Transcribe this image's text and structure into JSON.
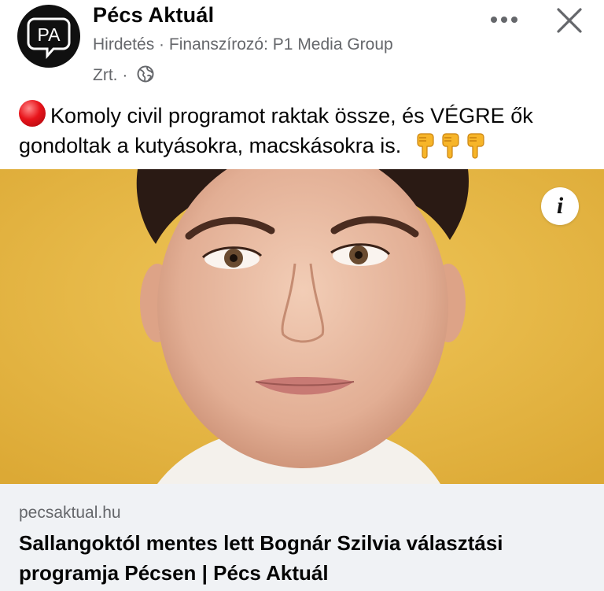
{
  "post": {
    "page_name": "Pécs Aktuál",
    "avatar_text": "PA",
    "sponsored_label": "Hirdetés",
    "separator": "·",
    "sponsor_prefix": "Finanszírozó:",
    "sponsor_name_part1": "P1 Media Group",
    "sponsor_name_part2": "Zrt.",
    "privacy_icon": "globe-icon",
    "more_label": "•••",
    "close_icon": "close-icon"
  },
  "caption": {
    "emoji_start": "red-circle",
    "line1": "Komoly civil programot raktak össze, és VÉGRE ők",
    "line2": "gondoltak a kutyásokra, macskásokra is.",
    "hand_emojis": [
      "pointing-down-hand",
      "pointing-down-hand",
      "pointing-down-hand"
    ]
  },
  "media": {
    "description_icon": "portrait-photo",
    "background_color": "#e4b441",
    "info_label": "i"
  },
  "link_preview": {
    "domain": "pecsaktual.hu",
    "title": "Sallangoktól mentes lett Bognár Szilvia választási programja Pécsen | Pécs Aktuál"
  }
}
